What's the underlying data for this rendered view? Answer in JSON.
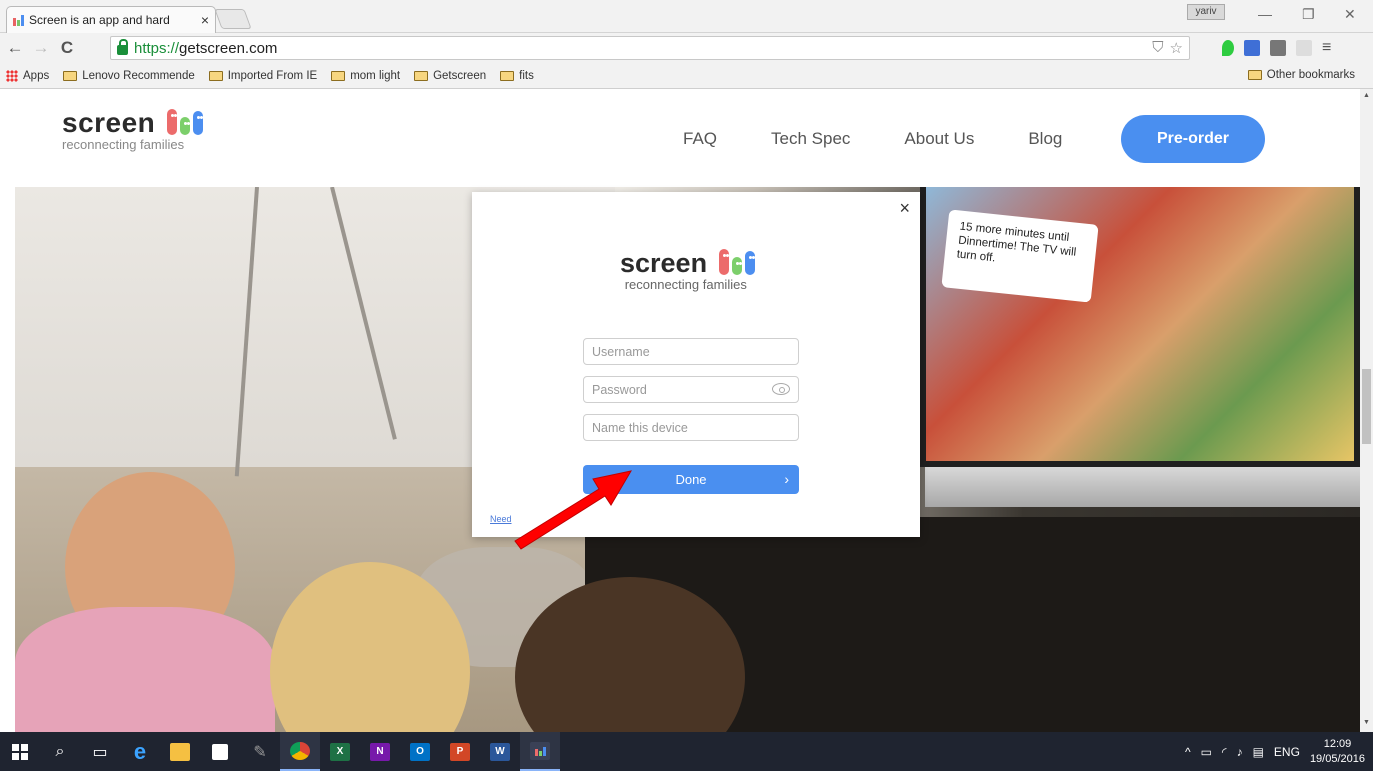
{
  "browser": {
    "tab_title": "Screen is an app and hard",
    "tab_close": "×",
    "user_chip": "yariv",
    "url_scheme": "https://",
    "url_host": "getscreen.com",
    "win_min": "—",
    "win_restore": "❐",
    "win_close": "✕",
    "nav_back": "←",
    "nav_forward": "→",
    "nav_reload": "C",
    "menu": "≡",
    "omni_shield": "⛉",
    "omni_star": "☆",
    "bookmarks": {
      "apps": "Apps",
      "items": [
        "Lenovo Recommende",
        "Imported From IE",
        "mom light",
        "Getscreen",
        "fits"
      ],
      "other": "Other bookmarks"
    }
  },
  "site": {
    "logo_word": "screen",
    "logo_tag": "reconnecting families",
    "nav": [
      "FAQ",
      "Tech Spec",
      "About Us",
      "Blog"
    ],
    "preorder": "Pre-order",
    "hero_bubble": "15 more minutes until Dinnertime! The TV will turn off."
  },
  "modal": {
    "close": "×",
    "logo_word": "screen",
    "logo_tag": "reconnecting families",
    "username_placeholder": "Username",
    "password_placeholder": "Password",
    "device_placeholder": "Name this device",
    "done_label": "Done",
    "done_chevron": "›",
    "need_link": "Need"
  },
  "colors": {
    "accent": "#4a8ff0",
    "pill_red": "#ec6b6b",
    "pill_green": "#7ccf6b",
    "pill_blue": "#4c8ef0",
    "arrow": "#ff0000"
  },
  "taskbar": {
    "tray_lang": "ENG",
    "time": "12:09",
    "date": "19/05/2016"
  }
}
